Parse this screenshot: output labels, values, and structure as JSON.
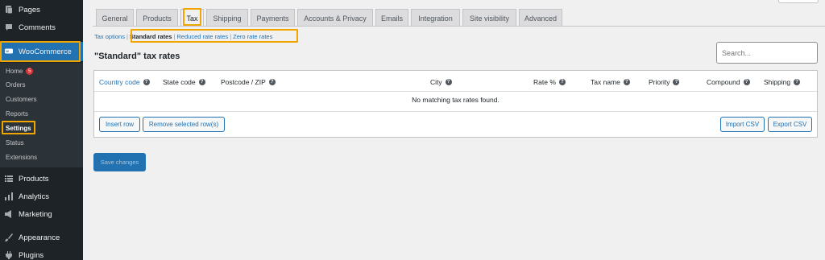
{
  "sidebar": {
    "top_items": [
      {
        "label": "Pages",
        "icon": "pages-icon"
      },
      {
        "label": "Comments",
        "icon": "comments-icon"
      },
      {
        "label": "WooCommerce",
        "icon": "woocommerce-icon"
      }
    ],
    "submenu": [
      {
        "label": "Home",
        "badge": "5"
      },
      {
        "label": "Orders"
      },
      {
        "label": "Customers"
      },
      {
        "label": "Reports"
      },
      {
        "label": "Settings"
      },
      {
        "label": "Status"
      },
      {
        "label": "Extensions"
      }
    ],
    "bottom_items": [
      {
        "label": "Products",
        "icon": "products-icon"
      },
      {
        "label": "Analytics",
        "icon": "analytics-icon"
      },
      {
        "label": "Marketing",
        "icon": "marketing-icon"
      },
      {
        "label": "Appearance",
        "icon": "appearance-icon"
      },
      {
        "label": "Plugins",
        "icon": "plugins-icon"
      }
    ]
  },
  "tabs": [
    "General",
    "Products",
    "Tax",
    "Shipping",
    "Payments",
    "Accounts & Privacy",
    "Emails",
    "Integration",
    "Site visibility",
    "Advanced"
  ],
  "subnav": {
    "tax_options": "Tax options",
    "standard": "Standard rates",
    "reduced": "Reduced rate rates",
    "zero": "Zero rate rates",
    "sep": "|"
  },
  "heading": "\"Standard\" tax rates",
  "search": {
    "placeholder": "Search..."
  },
  "table": {
    "columns": [
      "Country code",
      "State code",
      "Postcode / ZIP",
      "City",
      "Rate %",
      "Tax name",
      "Priority",
      "Compound",
      "Shipping"
    ],
    "empty_message": "No matching tax rates found.",
    "help_glyph": "?"
  },
  "buttons": {
    "insert_row": "Insert row",
    "remove_rows": "Remove selected row(s)",
    "import_csv": "Import CSV",
    "export_csv": "Export CSV",
    "save_changes": "Save changes"
  },
  "colors": {
    "highlight": "#f0a500",
    "accent": "#2271b1",
    "sidebar_bg": "#1d2327"
  }
}
